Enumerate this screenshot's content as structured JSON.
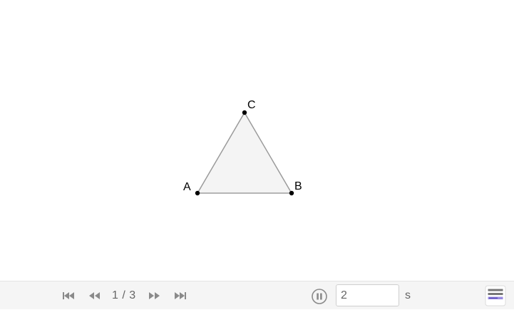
{
  "construction": {
    "points": [
      {
        "id": "A",
        "label": "A"
      },
      {
        "id": "B",
        "label": "B"
      },
      {
        "id": "C",
        "label": "C"
      }
    ],
    "polygon": {
      "vertices": [
        "A",
        "B",
        "C"
      ],
      "fill": "#f4f4f4",
      "stroke": "#9a9a9a"
    },
    "point_color": "#000000"
  },
  "navigation": {
    "first_step_icon": "skip-to-start-icon",
    "previous_step_icon": "rewind-icon",
    "step_counter": "1 / 3",
    "next_step_icon": "fast-forward-icon",
    "last_step_icon": "skip-to-end-icon",
    "play_icon": "pause-icon",
    "speed_value": "2",
    "speed_unit": "s",
    "algebra_icon": "algebra-view-icon",
    "icon_color": "#8a8a8a"
  }
}
